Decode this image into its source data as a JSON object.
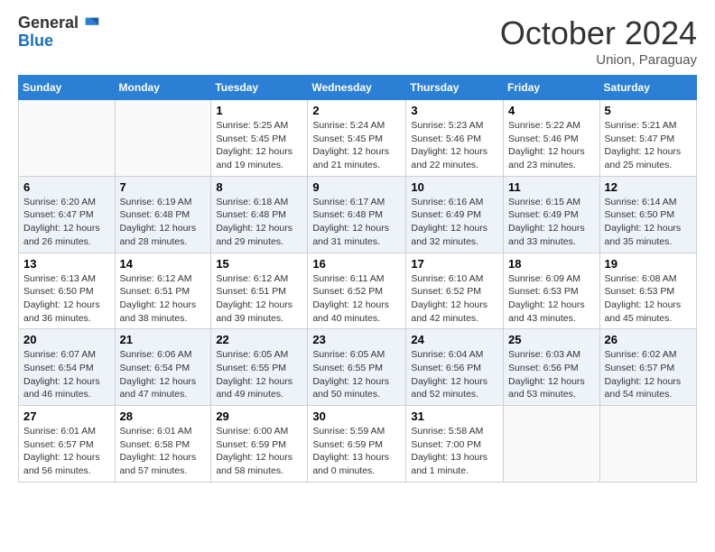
{
  "logo": {
    "general": "General",
    "blue": "Blue"
  },
  "header": {
    "month": "October 2024",
    "location": "Union, Paraguay"
  },
  "weekdays": [
    "Sunday",
    "Monday",
    "Tuesday",
    "Wednesday",
    "Thursday",
    "Friday",
    "Saturday"
  ],
  "weeks": [
    [
      {
        "day": "",
        "info": ""
      },
      {
        "day": "",
        "info": ""
      },
      {
        "day": "1",
        "info": "Sunrise: 5:25 AM\nSunset: 5:45 PM\nDaylight: 12 hours and 19 minutes."
      },
      {
        "day": "2",
        "info": "Sunrise: 5:24 AM\nSunset: 5:45 PM\nDaylight: 12 hours and 21 minutes."
      },
      {
        "day": "3",
        "info": "Sunrise: 5:23 AM\nSunset: 5:46 PM\nDaylight: 12 hours and 22 minutes."
      },
      {
        "day": "4",
        "info": "Sunrise: 5:22 AM\nSunset: 5:46 PM\nDaylight: 12 hours and 23 minutes."
      },
      {
        "day": "5",
        "info": "Sunrise: 5:21 AM\nSunset: 5:47 PM\nDaylight: 12 hours and 25 minutes."
      }
    ],
    [
      {
        "day": "6",
        "info": "Sunrise: 6:20 AM\nSunset: 6:47 PM\nDaylight: 12 hours and 26 minutes."
      },
      {
        "day": "7",
        "info": "Sunrise: 6:19 AM\nSunset: 6:48 PM\nDaylight: 12 hours and 28 minutes."
      },
      {
        "day": "8",
        "info": "Sunrise: 6:18 AM\nSunset: 6:48 PM\nDaylight: 12 hours and 29 minutes."
      },
      {
        "day": "9",
        "info": "Sunrise: 6:17 AM\nSunset: 6:48 PM\nDaylight: 12 hours and 31 minutes."
      },
      {
        "day": "10",
        "info": "Sunrise: 6:16 AM\nSunset: 6:49 PM\nDaylight: 12 hours and 32 minutes."
      },
      {
        "day": "11",
        "info": "Sunrise: 6:15 AM\nSunset: 6:49 PM\nDaylight: 12 hours and 33 minutes."
      },
      {
        "day": "12",
        "info": "Sunrise: 6:14 AM\nSunset: 6:50 PM\nDaylight: 12 hours and 35 minutes."
      }
    ],
    [
      {
        "day": "13",
        "info": "Sunrise: 6:13 AM\nSunset: 6:50 PM\nDaylight: 12 hours and 36 minutes."
      },
      {
        "day": "14",
        "info": "Sunrise: 6:12 AM\nSunset: 6:51 PM\nDaylight: 12 hours and 38 minutes."
      },
      {
        "day": "15",
        "info": "Sunrise: 6:12 AM\nSunset: 6:51 PM\nDaylight: 12 hours and 39 minutes."
      },
      {
        "day": "16",
        "info": "Sunrise: 6:11 AM\nSunset: 6:52 PM\nDaylight: 12 hours and 40 minutes."
      },
      {
        "day": "17",
        "info": "Sunrise: 6:10 AM\nSunset: 6:52 PM\nDaylight: 12 hours and 42 minutes."
      },
      {
        "day": "18",
        "info": "Sunrise: 6:09 AM\nSunset: 6:53 PM\nDaylight: 12 hours and 43 minutes."
      },
      {
        "day": "19",
        "info": "Sunrise: 6:08 AM\nSunset: 6:53 PM\nDaylight: 12 hours and 45 minutes."
      }
    ],
    [
      {
        "day": "20",
        "info": "Sunrise: 6:07 AM\nSunset: 6:54 PM\nDaylight: 12 hours and 46 minutes."
      },
      {
        "day": "21",
        "info": "Sunrise: 6:06 AM\nSunset: 6:54 PM\nDaylight: 12 hours and 47 minutes."
      },
      {
        "day": "22",
        "info": "Sunrise: 6:05 AM\nSunset: 6:55 PM\nDaylight: 12 hours and 49 minutes."
      },
      {
        "day": "23",
        "info": "Sunrise: 6:05 AM\nSunset: 6:55 PM\nDaylight: 12 hours and 50 minutes."
      },
      {
        "day": "24",
        "info": "Sunrise: 6:04 AM\nSunset: 6:56 PM\nDaylight: 12 hours and 52 minutes."
      },
      {
        "day": "25",
        "info": "Sunrise: 6:03 AM\nSunset: 6:56 PM\nDaylight: 12 hours and 53 minutes."
      },
      {
        "day": "26",
        "info": "Sunrise: 6:02 AM\nSunset: 6:57 PM\nDaylight: 12 hours and 54 minutes."
      }
    ],
    [
      {
        "day": "27",
        "info": "Sunrise: 6:01 AM\nSunset: 6:57 PM\nDaylight: 12 hours and 56 minutes."
      },
      {
        "day": "28",
        "info": "Sunrise: 6:01 AM\nSunset: 6:58 PM\nDaylight: 12 hours and 57 minutes."
      },
      {
        "day": "29",
        "info": "Sunrise: 6:00 AM\nSunset: 6:59 PM\nDaylight: 12 hours and 58 minutes."
      },
      {
        "day": "30",
        "info": "Sunrise: 5:59 AM\nSunset: 6:59 PM\nDaylight: 13 hours and 0 minutes."
      },
      {
        "day": "31",
        "info": "Sunrise: 5:58 AM\nSunset: 7:00 PM\nDaylight: 13 hours and 1 minute."
      },
      {
        "day": "",
        "info": ""
      },
      {
        "day": "",
        "info": ""
      }
    ]
  ]
}
